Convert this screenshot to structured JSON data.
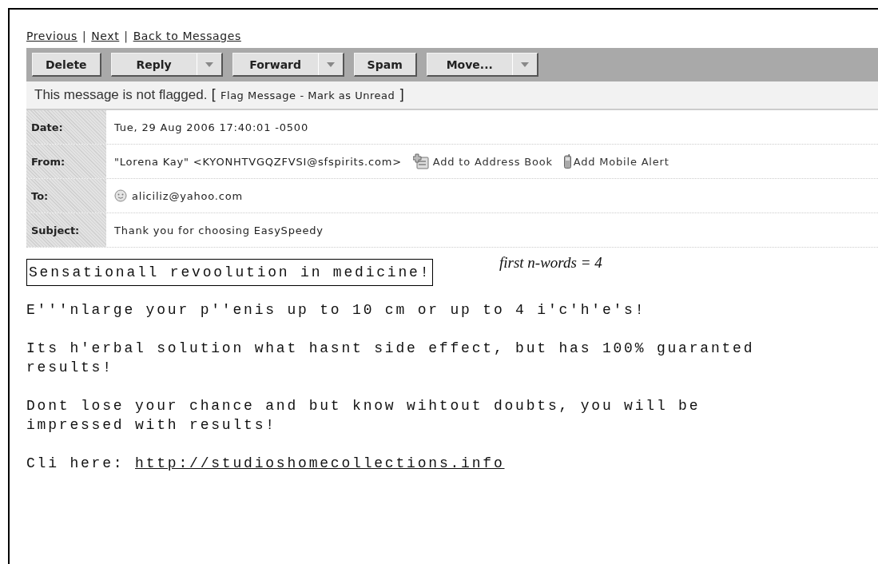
{
  "nav": [
    {
      "kind": "link",
      "text": "Previous"
    },
    {
      "kind": "separator",
      "text": "|"
    },
    {
      "kind": "link",
      "text": "Next"
    },
    {
      "kind": "separator",
      "text": "|"
    },
    {
      "kind": "link",
      "text": "Back to Messages"
    }
  ],
  "toolbar": [
    {
      "label": "Delete",
      "dropdown": false
    },
    {
      "label": "Reply",
      "dropdown": true
    },
    {
      "label": "Forward",
      "dropdown": true
    },
    {
      "label": "Spam",
      "dropdown": false
    },
    {
      "label": "Move...",
      "dropdown": true
    }
  ],
  "flag_bar": [
    {
      "kind": "status",
      "text": "This message is not flagged."
    },
    {
      "kind": "bracket",
      "text": "["
    },
    {
      "kind": "action",
      "text": "Flag Message"
    },
    {
      "kind": "separator",
      "text": "-"
    },
    {
      "kind": "action",
      "text": "Mark as Unread"
    },
    {
      "kind": "bracket",
      "text": "]"
    }
  ],
  "headers": [
    {
      "label": "Date:",
      "value": "Tue, 29 Aug 2006 17:40:01 -0500"
    },
    {
      "label": "From:",
      "value": "\"Lorena Kay\" <KYONHTVGQZFVSI@sfspirits.com>",
      "actions": [
        {
          "kind": "address-book",
          "text": "Add to Address Book"
        },
        {
          "kind": "mobile",
          "text": "Add Mobile Alert"
        }
      ]
    },
    {
      "label": "To:",
      "value": "aliciliz@yahoo.com",
      "contact_icon": true
    },
    {
      "label": "Subject:",
      "value": "Thank you for choosing EasySpeedy"
    }
  ],
  "annotation": "first n-words = 4",
  "body": [
    {
      "kind": "boxed",
      "lines": [
        "Sensationall revoolution in medicine!"
      ]
    },
    {
      "kind": "text",
      "lines": [
        "E'''nlarge your p''enis up to 10 cm or up to 4 i'c'h'e's!"
      ]
    },
    {
      "kind": "text",
      "lines": [
        "Its h'erbal solution what hasnt side effect, but has 100% guaranted",
        "results!"
      ]
    },
    {
      "kind": "text",
      "lines": [
        "Dont lose your chance and but know wihtout doubts, you will be",
        "impressed with results!"
      ]
    },
    {
      "kind": "link",
      "prefix": "Cli here:",
      "url": "http://studioshomecollections.info"
    }
  ]
}
